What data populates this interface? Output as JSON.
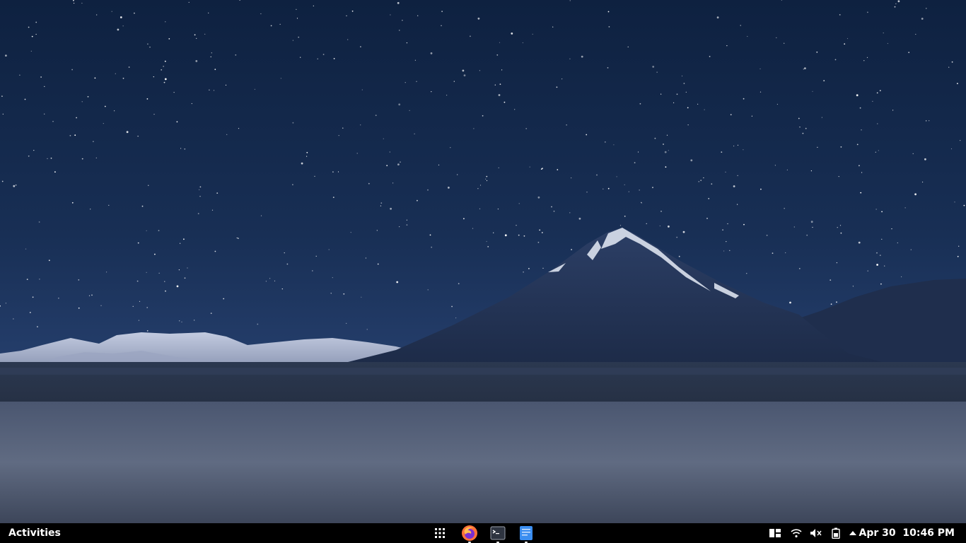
{
  "panel": {
    "activities_label": "Activities",
    "clock": {
      "date": "Apr 30",
      "time": "10:46 PM"
    }
  },
  "dock": {
    "items": [
      {
        "icon": "app-grid-icon"
      },
      {
        "icon": "firefox-icon"
      },
      {
        "icon": "terminal-icon"
      },
      {
        "icon": "text-editor-icon"
      }
    ]
  },
  "tray": {
    "icons": [
      "workspace-switcher-icon",
      "wifi-icon",
      "volume-muted-icon",
      "battery-icon",
      "menu-arrow-up-icon"
    ]
  },
  "colors": {
    "panel_bg": "#000000",
    "sky": "#152a4c",
    "accent_blue": "#3b8ef0"
  }
}
